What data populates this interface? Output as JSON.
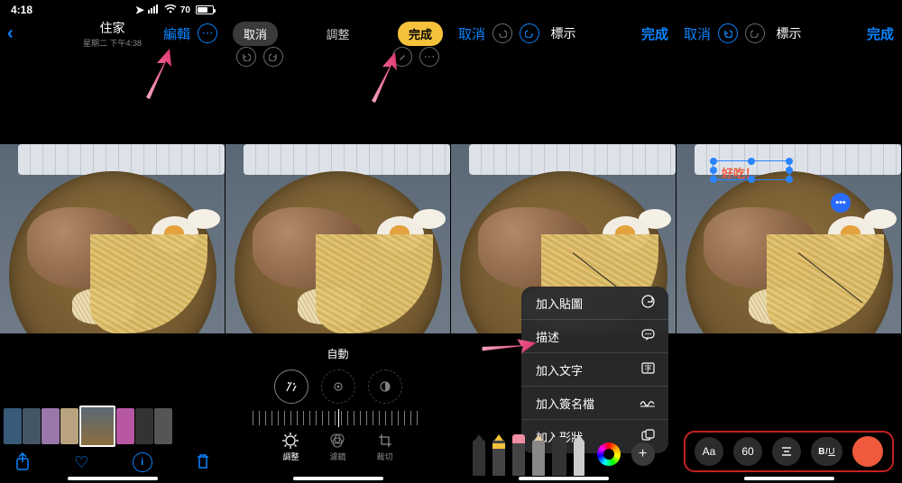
{
  "status": {
    "time": "4:18",
    "battery_pct": "70"
  },
  "p1": {
    "title": "住家",
    "subtitle": "星期二 下午4:38",
    "edit": "編輯"
  },
  "p2": {
    "cancel": "取消",
    "done": "完成",
    "center": "調整",
    "auto": "自動",
    "modes": {
      "adjust": "調整",
      "filter": "濾鏡",
      "crop": "裁切"
    }
  },
  "p3": {
    "cancel": "取消",
    "title": "標示",
    "done": "完成",
    "menu": {
      "sticker": "加入貼圖",
      "describe": "描述",
      "text": "加入文字",
      "signature": "加入簽名檔",
      "shape": "加入形狀"
    }
  },
  "p4": {
    "cancel": "取消",
    "title": "標示",
    "done": "完成",
    "typed_text": "好吃！",
    "toolbar": {
      "font": "Aa",
      "size": "60",
      "biu": "BIU"
    },
    "speech_dots": "•••"
  }
}
